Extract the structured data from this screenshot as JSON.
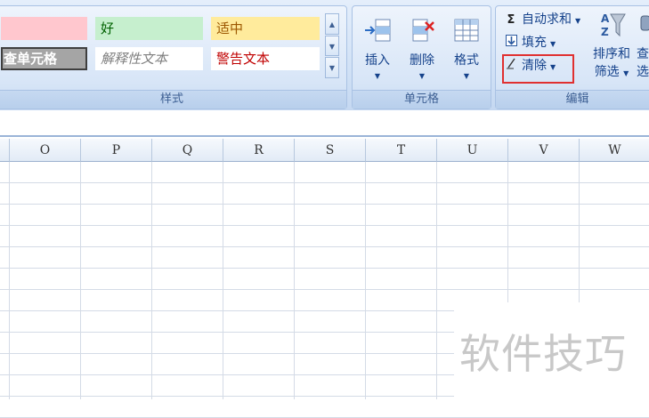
{
  "styles_group": {
    "label": "样式",
    "cells": {
      "good": "好",
      "neutral": "适中",
      "check_cell": "查单元格",
      "explanatory": "解释性文本",
      "warning": "警告文本"
    },
    "colors": {
      "bad_bg": "#ffc7ce",
      "good_bg": "#c6efce",
      "good_fg": "#006100",
      "neutral_bg": "#ffeb9c",
      "neutral_fg": "#9c5700",
      "check_bg": "#a5a5a5",
      "warning_fg": "#c00000"
    }
  },
  "cells_group": {
    "label": "单元格",
    "insert": "插入",
    "delete": "删除",
    "format": "格式"
  },
  "editing_group": {
    "label": "编辑",
    "autosum": "自动求和",
    "fill": "填充",
    "clear": "清除",
    "sort_filter_1": "排序和",
    "sort_filter_2": "筛选",
    "find_1": "查",
    "find_2": "选"
  },
  "sheet": {
    "columns": [
      "O",
      "P",
      "Q",
      "R",
      "S",
      "T",
      "U",
      "V",
      "W"
    ]
  },
  "watermark": "软件技巧"
}
